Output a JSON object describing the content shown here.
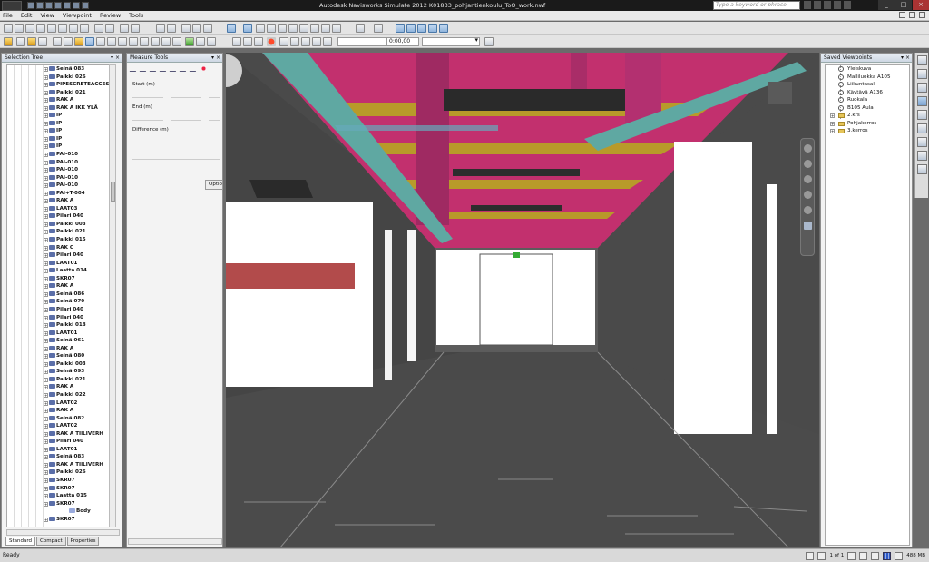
{
  "app": {
    "window_title": "Autodesk Navisworks Simulate 2012    K01833_pohjantienkoulu_ToO_work.nwf",
    "search_placeholder": "Type a keyword or phrase"
  },
  "menu": [
    "File",
    "Edit",
    "View",
    "Viewpoint",
    "Review",
    "Tools"
  ],
  "toolbar": {
    "time_value": "0:00,00"
  },
  "selection_tree": {
    "title": "Selection Tree",
    "items": [
      "Seinä 083",
      "Palkki 026",
      "PIPESCRETEACCES",
      "Palkki 021",
      "RAK A",
      "RAK A IKK YLÄ",
      "IP",
      "IP",
      "IP",
      "IP",
      "IP",
      "PAI-010",
      "PAI-010",
      "PAI-010",
      "PAI-010",
      "PAI-010",
      "PAI+T-004",
      "RAK A",
      "LAAT03",
      "Pilari 040",
      "Palkki 003",
      "Palkki 021",
      "Palkki 015",
      "RAK C",
      "Pilari 040",
      "LAAT01",
      "Laatta 014",
      "SKR07",
      "RAK A",
      "Seinä 086",
      "Seinä 070",
      "Pilari 040",
      "Pilari 040",
      "Palkki 018",
      "LAAT01",
      "Seinä 061",
      "RAK A",
      "Seinä 080",
      "Palkki 003",
      "Seinä 093",
      "Palkki 021",
      "RAK A",
      "Palkki 022",
      "LAAT02",
      "RAK A",
      "Seinä 082",
      "LAAT02",
      "RAK A TIILIVERH",
      "Pilari 040",
      "LAAT01",
      "Seinä 083",
      "RAK A TIILIVERH",
      "Palkki 026",
      "SKR07",
      "SKR07",
      "Laatta 015",
      "SKR07"
    ],
    "leaf": "Body",
    "last_item": "SKR07",
    "tabs": [
      "Standard",
      "Compact",
      "Properties"
    ]
  },
  "measure_tools": {
    "title": "Measure Tools",
    "start_label": "Start (m)",
    "end_label": "End (m)",
    "difference_label": "Difference (m)",
    "options_label": "Options"
  },
  "saved_viewpoints": {
    "title": "Saved Viewpoints",
    "views": [
      "Yleiskuva",
      "Malliluokka A105",
      "Liikuntasali",
      "Käytävä A136",
      "Ruokala",
      "B105 Aula"
    ],
    "folders": [
      "2.krs",
      "Pohjakerros",
      "3.kerros"
    ]
  },
  "status": {
    "left": "Ready",
    "page": "1 of 1",
    "memory": "488 MB"
  },
  "colors": {
    "ceiling_magenta": "#c2306e",
    "duct_yellow": "#b89a2a",
    "tray_teal": "#5fa8a2",
    "floor_gray": "#4d4d4d",
    "wall_white": "#ffffff",
    "accent_blue": "#4a78a8"
  }
}
